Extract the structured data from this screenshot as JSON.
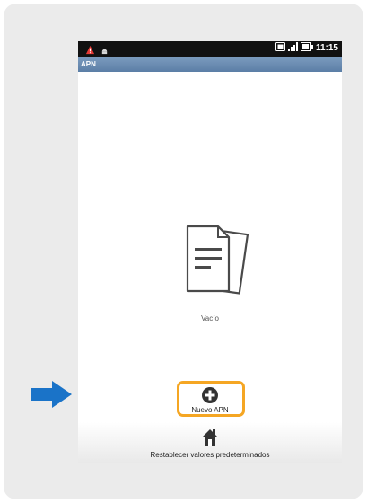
{
  "statusbar": {
    "time": "11:15",
    "left_icons": [
      "warning-icon",
      "android-icon"
    ],
    "right_icons": [
      "screenshot-icon",
      "signal-icon",
      "battery-icon"
    ]
  },
  "titlebar": {
    "title": "APN"
  },
  "empty_state": {
    "icon": "document-icon",
    "label": "Vacío"
  },
  "actions": {
    "new_apn": {
      "icon": "add-icon",
      "label": "Nuevo APN"
    },
    "reset_defaults": {
      "icon": "reset-icon",
      "label": "Restablecer valores predeterminados"
    }
  },
  "colors": {
    "status_bar": "#111111",
    "title_bar": "#5b7ea6",
    "highlight": "#f5a623",
    "arrow": "#1a73c8",
    "card": "#ebebeb"
  }
}
